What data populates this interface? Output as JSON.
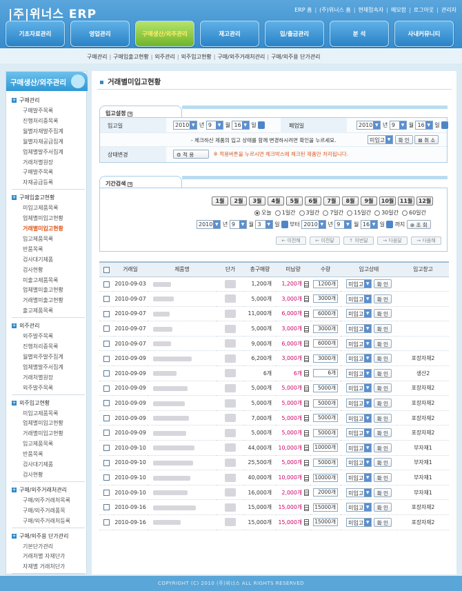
{
  "header": {
    "logo": "|주|위너스 ERP",
    "links": [
      "ERP 홈",
      "(주)위너스 홈",
      "현재접속자",
      "메모함",
      "로그아웃",
      "관리자"
    ]
  },
  "nav": [
    {
      "label": "기초자료관리"
    },
    {
      "label": "영업관리"
    },
    {
      "label": "구매생산/외주관리",
      "active": true
    },
    {
      "label": "재고관리"
    },
    {
      "label": "입/출금관리"
    },
    {
      "label": "분   석"
    },
    {
      "label": "사내커뮤니티"
    }
  ],
  "subnav": [
    "구매관리",
    "구매입출고현황",
    "외주관리",
    "외주입고현황",
    "구매/외주거래처관리",
    "구매/외주용 단가관리"
  ],
  "sidebar": {
    "title": "구매생산/외주관리",
    "groups": [
      {
        "title": "구매관리",
        "items": [
          "구매발주목록",
          "진행처리중목록",
          "월별자재발주집계",
          "월별자재공급집계",
          "업체별발주서집계",
          "거래처별원장",
          "구매발주목록",
          "자재공급등록"
        ]
      },
      {
        "title": "구매입출고현황",
        "items": [
          "미입고제품목록",
          "업체별미입고현황",
          "거래별미입고현황",
          "입고제품목록",
          "반품목록",
          "검사대기제품",
          "검사현황",
          "미출고제품목록",
          "업체별미출고현황",
          "거래별미출고현황",
          "출고제품목록"
        ]
      },
      {
        "title": "외주관리",
        "items": [
          "외주발주목록",
          "진행처리중목록",
          "월별외주발주집계",
          "업체별발주서집계",
          "거래처별원장",
          "외주발주목록"
        ]
      },
      {
        "title": "외주입고현황",
        "items": [
          "미입고제품목록",
          "업체별미입고현황",
          "거래별미입고현황",
          "입고제품목록",
          "반품목록",
          "검사대기제품",
          "검사현황"
        ]
      },
      {
        "title": "구매/외주거래처관리",
        "items": [
          "구매/외주거래처목록",
          "구매/외주거래품목",
          "구매/외주거래처등록"
        ]
      },
      {
        "title": "구매/외주용 단가관리",
        "items": [
          "기본단가관리",
          "거래처별 자재단가",
          "자재별 거래처단가"
        ]
      }
    ],
    "active_item": "거래별미입고현황"
  },
  "page_title": "거래별미입고현황",
  "settings": {
    "tab": "입고설정",
    "date_label": "입고일",
    "year": "2010",
    "month": "9",
    "day": "16",
    "y_unit": "년",
    "m_unit": "월",
    "d_unit": "일",
    "release_label": "폐업일",
    "r_year": "2010",
    "r_month": "9",
    "r_day": "16",
    "notice": "- 체크하신 제품의 입고 상태를 함께 변경하시려면 확인을 누르세요.",
    "status_sel": "미입고",
    "confirm": "확 인",
    "cancel": "취 소",
    "status_label": "상태변경",
    "apply": "적  용",
    "apply_note": "※ 적용버튼을 누르시면 체크박스에 체크된 제품만 처리됩니다."
  },
  "search": {
    "tab": "기간검색",
    "months": [
      "1월",
      "2월",
      "3월",
      "4월",
      "5월",
      "6월",
      "7월",
      "8월",
      "9월",
      "10월",
      "11월",
      "12월"
    ],
    "radios": [
      {
        "label": "오늘",
        "on": true
      },
      {
        "label": "1일간"
      },
      {
        "label": "3일간"
      },
      {
        "label": "7일간"
      },
      {
        "label": "15일간"
      },
      {
        "label": "30일간"
      },
      {
        "label": "60일간"
      }
    ],
    "from_year": "2010",
    "from_month": "9",
    "from_day": "3",
    "from_label": "부터",
    "to_year": "2010",
    "to_month": "9",
    "to_day": "16",
    "to_label": "까지",
    "search_btn": "조 회",
    "nav_btns": [
      "이전해",
      "이전달",
      "이번달",
      "다음달",
      "다음해"
    ]
  },
  "table": {
    "headers": [
      "거래일",
      "제품명",
      "단가",
      "총구매량",
      "미납량",
      "수량",
      "입고상태",
      "입고창고"
    ],
    "rows": [
      {
        "date": "2010-09-03",
        "total": "1,200개",
        "unpaid": "1,200개",
        "qty": "1200개",
        "status": "미입고",
        "btn": "확 인",
        "wh": "",
        "pw": 26
      },
      {
        "date": "2010-09-07",
        "total": "5,000개",
        "unpaid": "3,000개",
        "qty": "3000개",
        "status": "미입고",
        "btn": "확 인",
        "wh": "",
        "pw": 30
      },
      {
        "date": "2010-09-07",
        "total": "11,000개",
        "unpaid": "6,000개",
        "qty": "6000개",
        "status": "미입고",
        "btn": "확 인",
        "wh": "",
        "pw": 24
      },
      {
        "date": "2010-09-07",
        "total": "5,000개",
        "unpaid": "3,000개",
        "qty": "3000개",
        "status": "미입고",
        "btn": "확 인",
        "wh": "",
        "pw": 28
      },
      {
        "date": "2010-09-07",
        "total": "9,000개",
        "unpaid": "6,000개",
        "qty": "6000개",
        "status": "미입고",
        "btn": "확 인",
        "wh": "",
        "pw": 26
      },
      {
        "date": "2010-09-09",
        "total": "6,200개",
        "unpaid": "3,000개",
        "qty": "3000개",
        "status": "미입고",
        "btn": "확 인",
        "wh": "포장자재2",
        "pw": 56
      },
      {
        "date": "2010-09-09",
        "total": "6개",
        "unpaid": "6개",
        "qty": "6개",
        "status": "미입고",
        "btn": "확 인",
        "wh": "생산2",
        "pw": 34
      },
      {
        "date": "2010-09-09",
        "total": "5,000개",
        "unpaid": "5,000개",
        "qty": "5000개",
        "status": "미입고",
        "btn": "확 인",
        "wh": "포장자재2",
        "pw": 50
      },
      {
        "date": "2010-09-09",
        "total": "5,000개",
        "unpaid": "5,000개",
        "qty": "5000개",
        "status": "미입고",
        "btn": "확 인",
        "wh": "포장자재2",
        "pw": 46
      },
      {
        "date": "2010-09-09",
        "total": "7,000개",
        "unpaid": "5,000개",
        "qty": "5000개",
        "status": "미입고",
        "btn": "확 인",
        "wh": "포장자재2",
        "pw": 52
      },
      {
        "date": "2010-09-09",
        "total": "5,000개",
        "unpaid": "5,000개",
        "qty": "5000개",
        "status": "미입고",
        "btn": "확 인",
        "wh": "포장자재2",
        "pw": 48
      },
      {
        "date": "2010-09-10",
        "total": "44,000개",
        "unpaid": "10,000개",
        "qty": "10000개",
        "status": "미입고",
        "btn": "확 인",
        "wh": "부자재1",
        "pw": 60
      },
      {
        "date": "2010-09-10",
        "total": "25,500개",
        "unpaid": "5,000개",
        "qty": "5000개",
        "status": "미입고",
        "btn": "확 인",
        "wh": "부자재1",
        "pw": 58
      },
      {
        "date": "2010-09-10",
        "total": "40,000개",
        "unpaid": "10,000개",
        "qty": "10000개",
        "status": "미입고",
        "btn": "확 인",
        "wh": "부자재1",
        "pw": 54
      },
      {
        "date": "2010-09-10",
        "total": "16,000개",
        "unpaid": "2,000개",
        "qty": "2000개",
        "status": "미입고",
        "btn": "확 인",
        "wh": "부자재1",
        "pw": 50
      },
      {
        "date": "2010-09-16",
        "total": "15,000개",
        "unpaid": "15,000개",
        "qty": "15000개",
        "status": "미입고",
        "btn": "확 인",
        "wh": "포장자재2",
        "pw": 62
      },
      {
        "date": "2010-09-16",
        "total": "15,000개",
        "unpaid": "15,000개",
        "qty": "15000개",
        "status": "미입고",
        "btn": "확 인",
        "wh": "포장자재2",
        "pw": 40
      }
    ]
  },
  "footer": "COPYRIGHT (C) 2010 (주)위너스 ALL RIGHTS RESERVED"
}
